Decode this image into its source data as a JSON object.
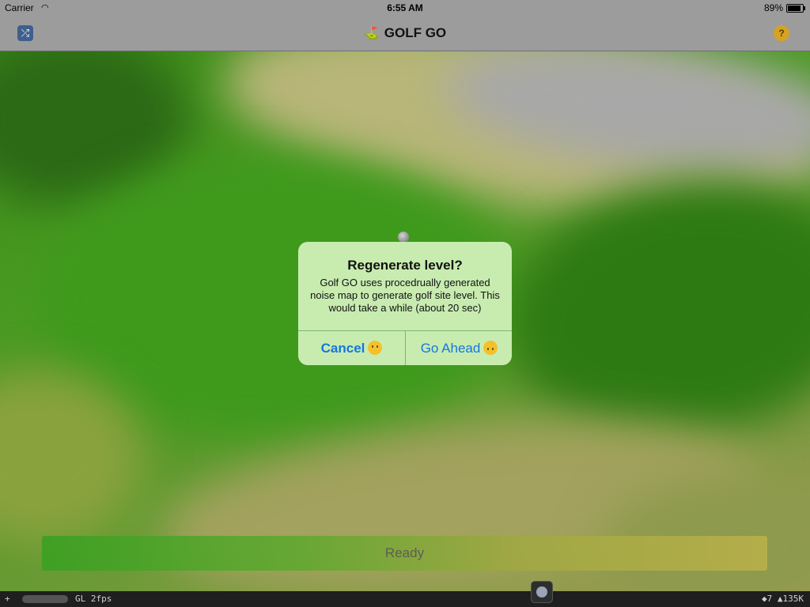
{
  "status_bar": {
    "carrier": "Carrier",
    "wifi_icon": "wifi-icon",
    "time": "6:55 AM",
    "battery_percent": "89%",
    "battery_level": 0.89
  },
  "nav_bar": {
    "title": "GOLF GO",
    "title_icon": "golf-flag-icon",
    "left_button_icon": "shuffle-icon",
    "right_button_icon": "thinking-face-icon"
  },
  "alert": {
    "title": "Regenerate level?",
    "message": "Golf GO uses procedrually generated noise map to generate golf site level. This would take a while (about 20 sec)",
    "buttons": [
      {
        "label": "Cancel",
        "icon": "expressionless-face-icon"
      },
      {
        "label": "Go Ahead",
        "icon": "upside-down-face-icon"
      }
    ]
  },
  "bottom_bar": {
    "status_text": "Ready"
  },
  "debug_bar": {
    "plus": "+",
    "renderer_info": "GL 2fps",
    "stats": "◆7 ▲135K"
  },
  "colors": {
    "alert_background": "#c8ecb0",
    "button_text": "#1676e0",
    "bars_background": "#9c9c9c"
  }
}
